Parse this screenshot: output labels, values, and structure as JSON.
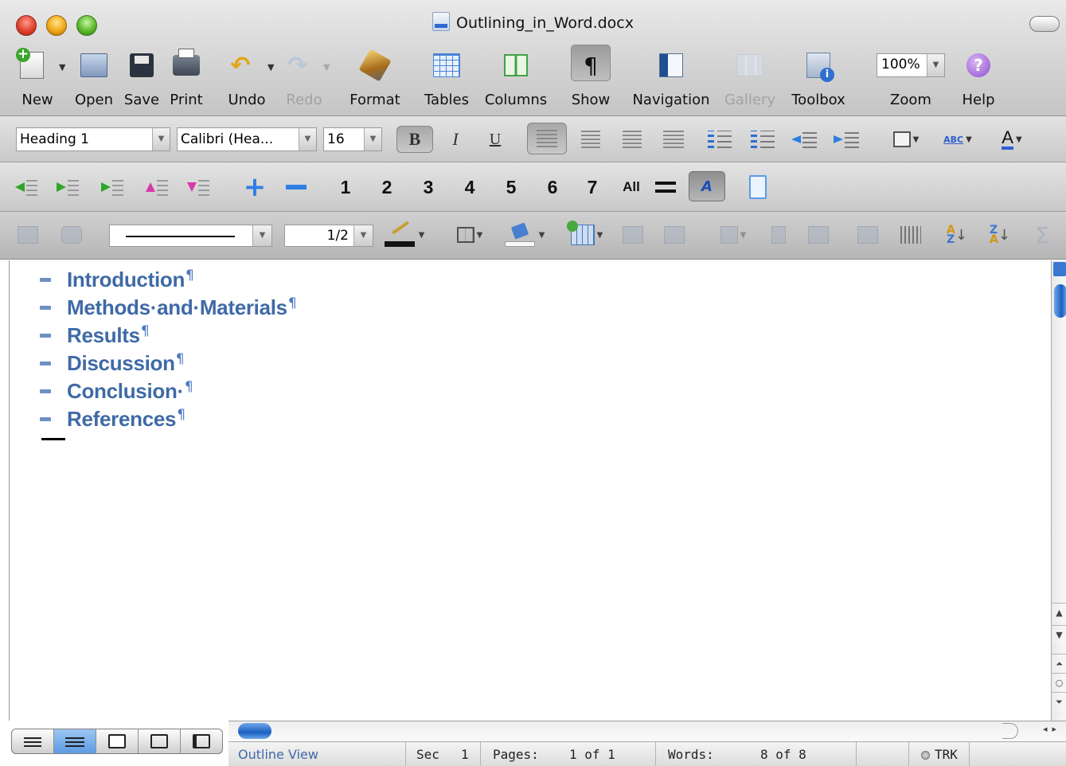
{
  "window": {
    "title": "Outlining_in_Word.docx"
  },
  "toolbar": {
    "new": "New",
    "open": "Open",
    "save": "Save",
    "print": "Print",
    "undo": "Undo",
    "redo": "Redo",
    "format": "Format",
    "tables": "Tables",
    "columns": "Columns",
    "show": "Show",
    "navigation": "Navigation",
    "gallery": "Gallery",
    "toolbox": "Toolbox",
    "zoom": "Zoom",
    "zoom_value": "100%",
    "help": "Help"
  },
  "formatting": {
    "style": "Heading 1",
    "font": "Calibri (Hea...",
    "size": "16",
    "bold": "B",
    "italic": "I",
    "underline": "U",
    "highlight": "ABC",
    "font_color": "A"
  },
  "outlining": {
    "levels": [
      "1",
      "2",
      "3",
      "4",
      "5",
      "6",
      "7"
    ],
    "all": "All",
    "show_formatting": "A"
  },
  "tables_borders": {
    "line_weight": "1/2"
  },
  "document": {
    "headings": [
      "Introduction",
      "Methods·and·Materials",
      "Results",
      "Discussion",
      "Conclusion·",
      "References"
    ],
    "pilcrow": "¶"
  },
  "status": {
    "view": "Outline View",
    "sec_label": "Sec",
    "sec_value": "1",
    "pages_label": "Pages:",
    "pages_value": "1 of 1",
    "words_label": "Words:",
    "words_value": "8 of 8",
    "trk": "TRK"
  },
  "colors": {
    "heading": "#3f6aa6",
    "accent": "#2f7fe3"
  }
}
